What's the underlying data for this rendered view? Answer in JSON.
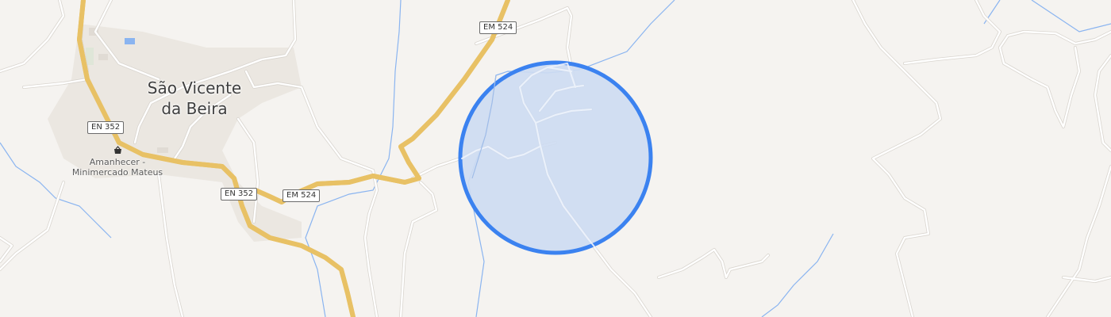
{
  "map": {
    "town": {
      "line1": "São Vicente",
      "line2": "da Beira"
    },
    "road_shields": {
      "em524_top": "EM 524",
      "em524_mid": "EM 524",
      "en352_left": "EN 352",
      "en352_mid": "EN 352"
    },
    "poi": {
      "name_line1": "Amanhecer -",
      "name_line2": "Minimercado Mateus",
      "icon": "shopping-basket-icon"
    },
    "accuracy_circle": {
      "fill": "#cddcf2",
      "stroke": "#3b82f0"
    },
    "colors": {
      "background": "#f5f3f0",
      "major_road": "#f7d98a",
      "major_road_casing": "#e8c165",
      "minor_road": "#ffffff",
      "minor_road_casing": "#d9d5cf",
      "water": "#8ab4f0",
      "built_up": "#ebe7e1"
    }
  }
}
